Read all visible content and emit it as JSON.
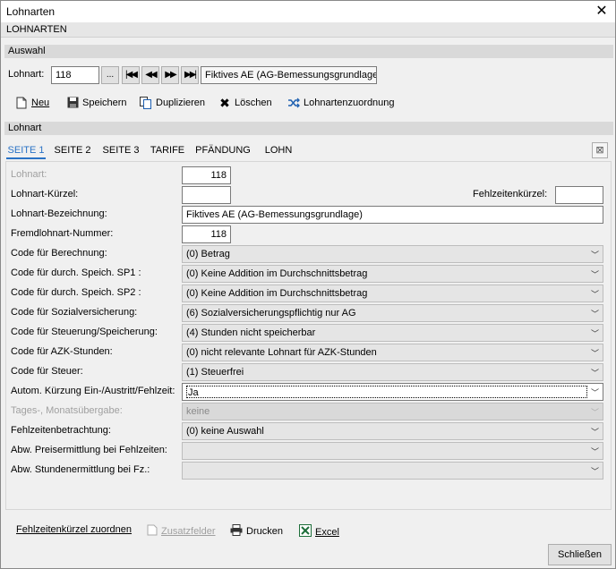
{
  "window": {
    "title": "Lohnarten",
    "close_glyph": "✕"
  },
  "header": {
    "title": "LOHNARTEN"
  },
  "auswahl": {
    "section_title": "Auswahl",
    "label": "Lohnart:",
    "value": "118",
    "browse_glyph": "...",
    "nav_first": "|◀◀",
    "nav_prev": "◀◀",
    "nav_next": "▶▶",
    "nav_last": "▶▶|",
    "description": "Fiktives AE (AG-Bemessungsgrundlage)"
  },
  "toolbar": {
    "new_label": "Neu",
    "save_label": "Speichern",
    "duplicate_label": "Duplizieren",
    "delete_label": "Löschen",
    "assign_label": "Lohnartenzuordnung"
  },
  "lohnart": {
    "section_title": "Lohnart",
    "tabs": [
      "SEITE 1",
      "SEITE 2",
      "SEITE 3",
      "TARIFE",
      "PFÄNDUNG",
      "LOHN"
    ],
    "active_tab": 0
  },
  "form": {
    "lohnart_label": "Lohnart:",
    "lohnart_value": "118",
    "kuerzel_label": "Lohnart-Kürzel:",
    "kuerzel_value": "",
    "fehlzeiten_kuerzel_label": "Fehlzeitenkürzel:",
    "fehlzeiten_kuerzel_value": "",
    "bezeichnung_label": "Lohnart-Bezeichnung:",
    "bezeichnung_value": "Fiktives AE (AG-Bemessungsgrundlage)",
    "fremd_label": "Fremdlohnart-Nummer:",
    "fremd_value": "118",
    "fields": [
      {
        "label": "Code für Berechnung:",
        "value": "(0) Betrag"
      },
      {
        "label": "Code für durch. Speich. SP1 :",
        "value": "(0) Keine Addition im Durchschnittsbetrag"
      },
      {
        "label": "Code für durch. Speich. SP2 :",
        "value": "(0) Keine Addition im Durchschnittsbetrag"
      },
      {
        "label": "Code für Sozialversicherung:",
        "value": "(6) Sozialversicherungspflichtig nur AG"
      },
      {
        "label": "Code für Steuerung/Speicherung:",
        "value": "(4) Stunden nicht speicherbar"
      },
      {
        "label": "Code für AZK-Stunden:",
        "value": "(0) nicht relevante Lohnart für AZK-Stunden"
      },
      {
        "label": "Code für Steuer:",
        "value": "(1) Steuerfrei"
      },
      {
        "label": "Autom. Kürzung Ein-/Austritt/Fehlzeit:",
        "value": "Ja"
      },
      {
        "label": "Tages-, Monatsübergabe:",
        "value": "keine"
      },
      {
        "label": "Fehlzeitenbetrachtung:",
        "value": "(0) keine Auswahl"
      },
      {
        "label": "Abw. Preisermittlung bei Fehlzeiten:",
        "value": ""
      },
      {
        "label": "Abw. Stundenermittlung bei Fz.:",
        "value": ""
      }
    ]
  },
  "bottom": {
    "fehlzeiten_label": "Fehlzeitenkürzel zuordnen",
    "zusatz_label": "Zusatzfelder",
    "print_label": "Drucken",
    "excel_label": "Excel",
    "close_label": "Schließen"
  }
}
